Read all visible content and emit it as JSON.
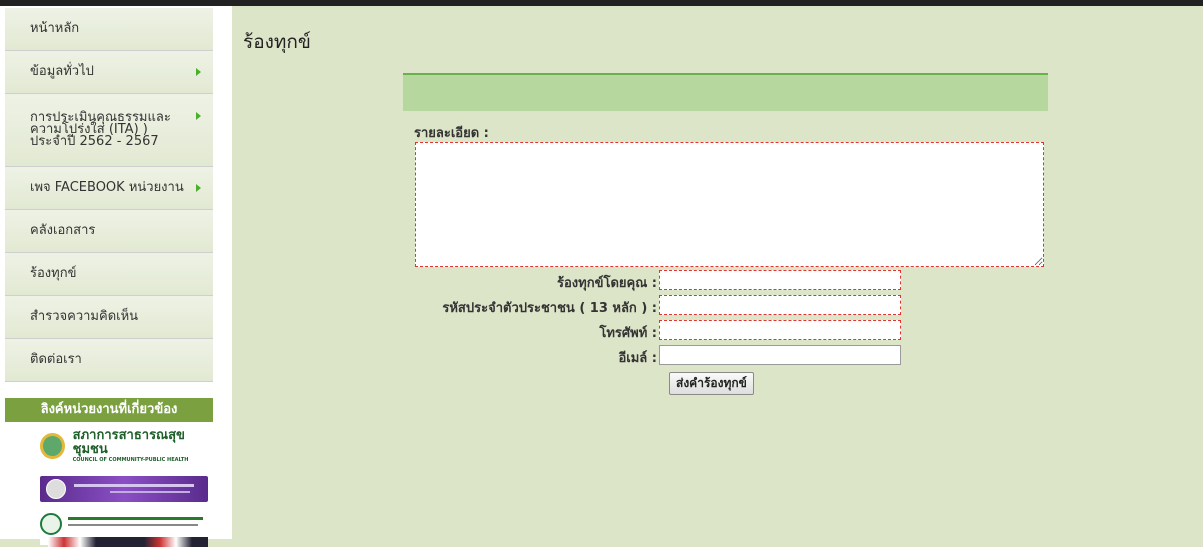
{
  "sidebar": {
    "items": [
      {
        "label": "หน้าหลัก",
        "has_arrow": false
      },
      {
        "label": "ข้อมูลทั่วไป",
        "has_arrow": true
      },
      {
        "label": "การประเมินคุณธรรมและความโปร่งใส (ITA) ) ประจำปี 2562 - 2567",
        "has_arrow": true
      },
      {
        "label": "เพจ FACEBOOK หน่วยงาน",
        "has_arrow": true
      },
      {
        "label": "คลังเอกสาร",
        "has_arrow": false
      },
      {
        "label": "ร้องทุกข์",
        "has_arrow": false
      },
      {
        "label": "สำรวจความคิดเห็น",
        "has_arrow": false
      },
      {
        "label": "ติดต่อเรา",
        "has_arrow": false
      }
    ],
    "links_title": "ลิงค์หน่วยงานที่เกี่ยวข้อง",
    "logos": [
      {
        "name": "สภาการสาธารณสุขชุมชน",
        "sub": "COUNCIL OF COMMUNITY-PUBLIC HEALTH"
      }
    ]
  },
  "main": {
    "title": "ร้องทุกข์",
    "detail_label": "รายละเอียด :",
    "fields": [
      {
        "label": "ร้องทุกข์โดยคุณ :",
        "value": "",
        "required": true
      },
      {
        "label": "รหัสประจำตัวประชาชน ( 13 หลัก ) :",
        "value": "",
        "required": true
      },
      {
        "label": "โทรศัพท์ :",
        "value": "",
        "required": true
      },
      {
        "label": "อีเมล์ :",
        "value": "",
        "required": false
      }
    ],
    "submit_label": "ส่งคำร้องทุกข์"
  },
  "colors": {
    "background": "#dde5c9",
    "accent_green": "#7aa040",
    "header_band": "#b6d89e",
    "required_border": "#e0342c"
  }
}
